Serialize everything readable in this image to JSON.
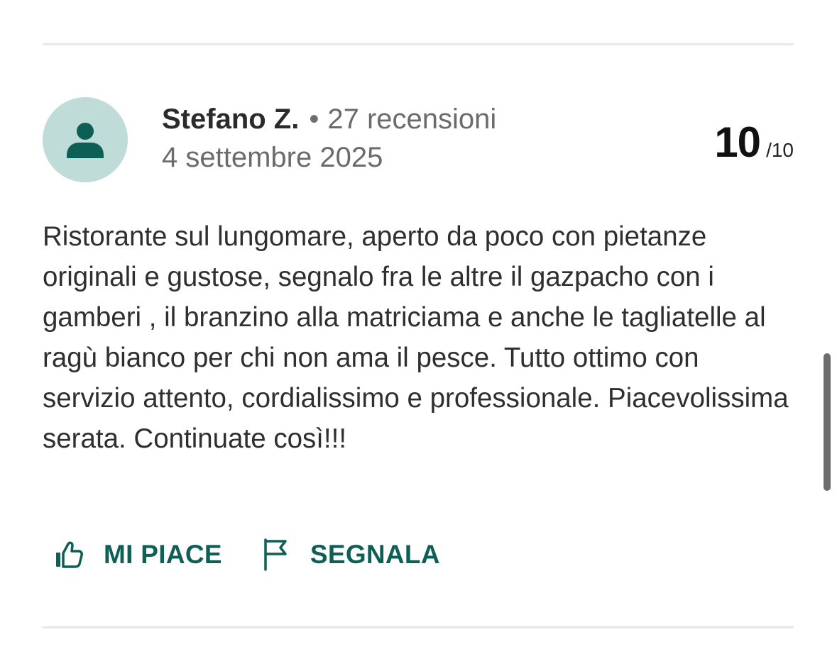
{
  "review": {
    "reviewer_name": "Stefano Z.",
    "separator": "•",
    "review_count": "27 recensioni",
    "date": "4 settembre 2025",
    "score": "10",
    "score_max": "/10",
    "text": "Ristorante sul lungomare, aperto da poco con pietanze originali e gustose, segnalo fra le altre il gazpacho con i gamberi , il branzino alla matriciama e anche le tagliatelle al ragù bianco per chi non ama il pesce. Tutto ottimo con servizio attento, cordialissimo e professionale. Piacevolissima serata. Continuate così!!!"
  },
  "actions": {
    "like_label": "MI PIACE",
    "report_label": "SEGNALA"
  },
  "icons": {
    "avatar": "user-icon",
    "like": "thumbs-up-icon",
    "report": "flag-icon"
  },
  "colors": {
    "accent": "#0f5f56",
    "avatar_bg": "#bfdcd8",
    "avatar_fg": "#0d5f55"
  }
}
